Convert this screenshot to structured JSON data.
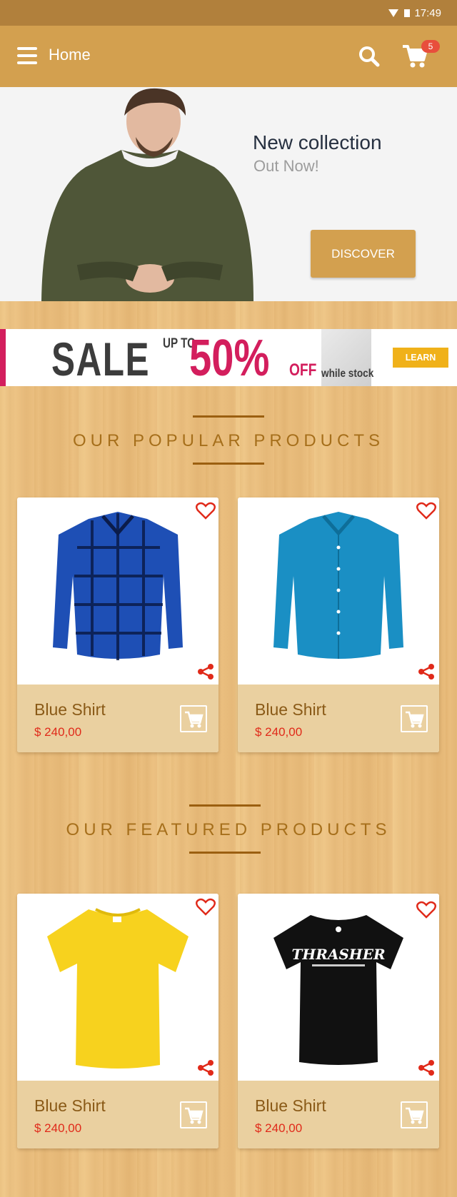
{
  "status_bar": {
    "time": "17:49"
  },
  "app_bar": {
    "title": "Home",
    "cart_count": "5"
  },
  "hero": {
    "title": "New collection",
    "subtitle": "Out Now!",
    "button_label": "DISCOVER"
  },
  "sale_banner": {
    "sale": "SALE",
    "up_to": "UP TO",
    "percent": "50%",
    "off": "OFF",
    "while_stock": "while stock",
    "button_label": "LEARN MORE"
  },
  "popular": {
    "title": "OUR POPULAR PRODUCTS",
    "products": [
      {
        "name": "Blue Shirt",
        "price": "$ 240,00",
        "image": "plaid-shirt"
      },
      {
        "name": "Blue Shirt",
        "price": "$ 240,00",
        "image": "blue-shirt"
      }
    ]
  },
  "featured": {
    "title": "OUR FEATURED PRODUCTS",
    "products": [
      {
        "name": "Blue Shirt",
        "price": "$ 240,00",
        "image": "yellow-tshirt"
      },
      {
        "name": "Blue Shirt",
        "price": "$ 240,00",
        "image": "black-tshirt"
      }
    ],
    "tshirt_print": "THRASHER"
  },
  "colors": {
    "status_bar": "#b1803c",
    "app_bar": "#d3a04f",
    "accent_red": "#e02a1a",
    "sale_pink": "#d31e5d",
    "card_footer": "#ead0a0"
  }
}
